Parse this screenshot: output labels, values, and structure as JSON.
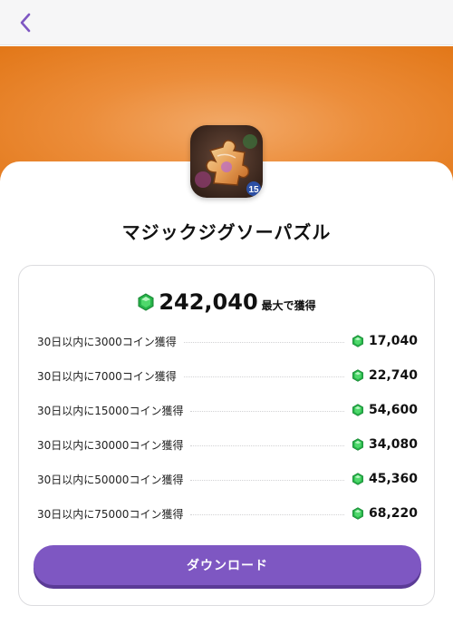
{
  "header": {
    "back_icon": "chevron-left-icon",
    "accent_color": "#7e57c2"
  },
  "app": {
    "title": "マジックジグソーパズル",
    "icon": "puzzle-piece-icon",
    "icon_badge": "15"
  },
  "rewards": {
    "total_amount": "242,040",
    "total_caption": "最大で獲得",
    "gem_icon": "green-gem-icon",
    "items": [
      {
        "label": "30日以内に3000コイン獲得",
        "value": "17,040"
      },
      {
        "label": "30日以内に7000コイン獲得",
        "value": "22,740"
      },
      {
        "label": "30日以内に15000コイン獲得",
        "value": "54,600"
      },
      {
        "label": "30日以内に30000コイン獲得",
        "value": "34,080"
      },
      {
        "label": "30日以内に50000コイン獲得",
        "value": "45,360"
      },
      {
        "label": "30日以内に75000コイン獲得",
        "value": "68,220"
      }
    ]
  },
  "cta": {
    "download_label": "ダウンロード",
    "color": "#7e57c2"
  }
}
